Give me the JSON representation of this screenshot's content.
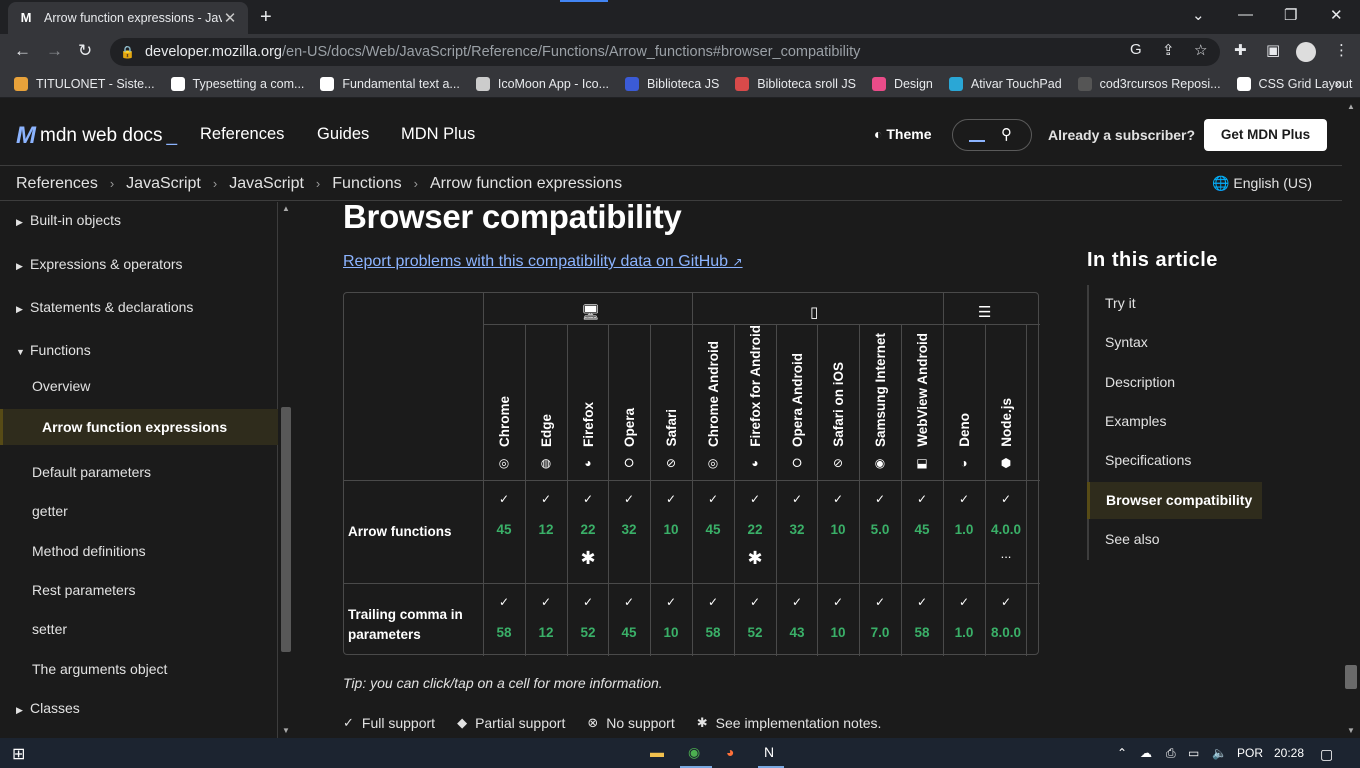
{
  "browser": {
    "tab_title": "Arrow function expressions - Java",
    "tab_favicon": "M",
    "url_host": "developer.mozilla.org",
    "url_path": "/en-US/docs/Web/JavaScript/Reference/Functions/Arrow_functions#browser_compatibility",
    "bookmarks": [
      {
        "label": "TITULONET - Siste...",
        "color": "#e8a23a"
      },
      {
        "label": "Typesetting a com...",
        "color": "#ffffff"
      },
      {
        "label": "Fundamental text a...",
        "color": "#ffffff"
      },
      {
        "label": "IcoMoon App - Ico...",
        "color": "#cccccc"
      },
      {
        "label": "Biblioteca JS",
        "color": "#3b5bd6"
      },
      {
        "label": "Biblioteca sroll JS",
        "color": "#d84a4a"
      },
      {
        "label": "Design",
        "color": "#ea4c89"
      },
      {
        "label": "Ativar TouchPad",
        "color": "#2aa7d6"
      },
      {
        "label": "cod3rcursos Reposi...",
        "color": "#555555"
      },
      {
        "label": "CSS Grid Layout",
        "color": "#ffffff"
      }
    ]
  },
  "header": {
    "logo": "mdn web docs",
    "nav": [
      "References",
      "Guides",
      "MDN Plus"
    ],
    "theme": "Theme",
    "subscriber": "Already a subscriber?",
    "get_plus": "Get MDN Plus"
  },
  "breadcrumbs": [
    "References",
    "JavaScript",
    "JavaScript",
    "Functions",
    "Arrow function expressions"
  ],
  "language": "English (US)",
  "sidebar": [
    {
      "label": "Built-in objects",
      "tri": "▶",
      "top": 0
    },
    {
      "label": "Expressions & operators",
      "tri": "▶"
    },
    {
      "label": "Statements & declarations",
      "tri": "▶"
    },
    {
      "label": "Functions",
      "tri": "▼"
    },
    {
      "label": "Overview"
    },
    {
      "label": "Arrow function expressions",
      "active": true
    },
    {
      "label": "Default parameters"
    },
    {
      "label": "getter"
    },
    {
      "label": "Method definitions"
    },
    {
      "label": "Rest parameters"
    },
    {
      "label": "setter"
    },
    {
      "label": "The arguments object"
    },
    {
      "label": "Classes",
      "tri": "▶"
    }
  ],
  "main": {
    "heading": "Browser compatibility",
    "report_link": "Report problems with this compatibility data on GitHub",
    "tip": "Tip: you can click/tap on a cell for more information."
  },
  "compat": {
    "browsers": [
      {
        "name": "Chrome",
        "icon": "chrome-icon"
      },
      {
        "name": "Edge",
        "icon": "edge-icon"
      },
      {
        "name": "Firefox",
        "icon": "firefox-icon"
      },
      {
        "name": "Opera",
        "icon": "opera-icon"
      },
      {
        "name": "Safari",
        "icon": "safari-icon"
      },
      {
        "name": "Chrome Android",
        "icon": "chrome-icon"
      },
      {
        "name": "Firefox for Android",
        "icon": "firefox-icon"
      },
      {
        "name": "Opera Android",
        "icon": "opera-icon"
      },
      {
        "name": "Safari on iOS",
        "icon": "safari-icon"
      },
      {
        "name": "Samsung Internet",
        "icon": "samsung-internet-icon"
      },
      {
        "name": "WebView Android",
        "icon": "android-icon"
      },
      {
        "name": "Deno",
        "icon": "deno-icon"
      },
      {
        "name": "Node.js",
        "icon": "nodejs-icon"
      }
    ],
    "rows": [
      {
        "label": "Arrow functions",
        "versions": [
          "45",
          "12",
          "22",
          "32",
          "10",
          "45",
          "22",
          "32",
          "10",
          "5.0",
          "45",
          "1.0",
          "4.0.0"
        ],
        "notes": [
          "",
          "",
          "*",
          "",
          "",
          "",
          "*",
          "",
          "",
          "",
          "",
          "",
          "..."
        ]
      },
      {
        "label": "Trailing comma in parameters",
        "versions": [
          "58",
          "12",
          "52",
          "45",
          "10",
          "58",
          "52",
          "43",
          "10",
          "7.0",
          "58",
          "1.0",
          "8.0.0"
        ],
        "notes": [
          "",
          "",
          "",
          "",
          "",
          "",
          "",
          "",
          "",
          "",
          "",
          "",
          ""
        ]
      }
    ]
  },
  "legend": [
    {
      "label": "Full support",
      "icon": "check-icon",
      "glyph": "✓"
    },
    {
      "label": "Partial support",
      "icon": "partial-icon",
      "glyph": "◆"
    },
    {
      "label": "No support",
      "icon": "no-support-icon",
      "glyph": "⊗"
    },
    {
      "label": "See implementation notes.",
      "icon": "asterisk-icon",
      "glyph": "✱"
    }
  ],
  "toc": {
    "title": "In this article",
    "items": [
      "Try it",
      "Syntax",
      "Description",
      "Examples",
      "Specifications",
      "Browser compatibility",
      "See also"
    ],
    "active": 5
  },
  "taskbar": {
    "lang": "POR",
    "time": "20:28"
  }
}
